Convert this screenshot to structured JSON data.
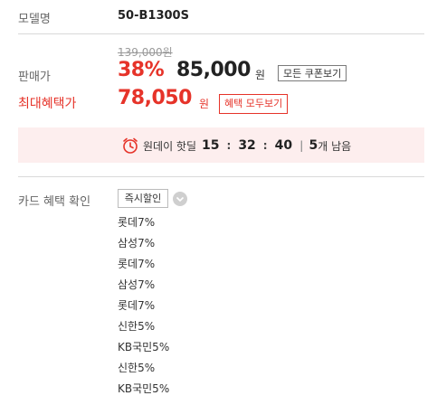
{
  "model": {
    "label": "모델명",
    "value": "50-B1300S"
  },
  "price": {
    "original": "139,000원",
    "label": "판매가",
    "discount_percent": "38%",
    "sale_price": "85,000",
    "currency": "원",
    "coupon_button": "모든 쿠폰보기"
  },
  "benefit": {
    "label": "최대혜택가",
    "price": "78,050",
    "currency": "원",
    "button": "혜택 모두보기"
  },
  "deal": {
    "text": "원데이 핫딜",
    "hours": "15",
    "minutes": "32",
    "seconds": "40",
    "remaining_count": "5",
    "remaining_suffix": "개 남음"
  },
  "card": {
    "label": "카드 혜택 확인",
    "select_value": "즉시할인",
    "items": [
      "롯데7%",
      "삼성7%",
      "롯데7%",
      "삼성7%",
      "롯데7%",
      "신한5%",
      "KB국민5%",
      "신한5%",
      "KB국민5%"
    ]
  },
  "colors": {
    "accent": "#e63329",
    "deal_bg": "#fdeeee",
    "divider": "#d9d9d9"
  },
  "icons": {
    "timer": "clock-icon",
    "dropdown": "chevron-down-icon"
  }
}
